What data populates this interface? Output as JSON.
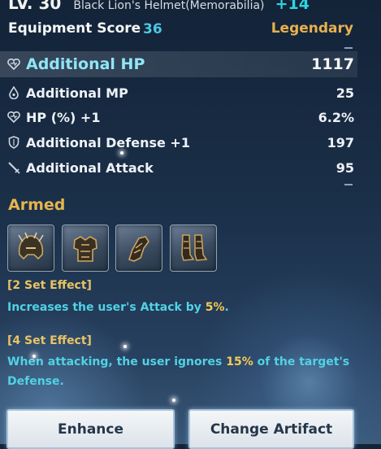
{
  "header": {
    "level": "LV. 30",
    "item_name": "Black Lion's Helmet(Memorabilia)",
    "enhance_level": "+14"
  },
  "score": {
    "label": "Equipment Score",
    "value": "36",
    "rarity": "Legendary"
  },
  "stats": [
    {
      "label": "Additional HP",
      "value": "1117",
      "icon": "heart-icon"
    },
    {
      "label": "Additional MP",
      "value": "25",
      "icon": "droplet-icon"
    },
    {
      "label": "HP (%) +1",
      "value": "6.2%",
      "icon": "heart-icon"
    },
    {
      "label": "Additional Defense +1",
      "value": "197",
      "icon": "shield-icon"
    },
    {
      "label": "Additional Attack",
      "value": "95",
      "icon": "sword-icon"
    }
  ],
  "armed": {
    "title": "Armed",
    "slots": [
      {
        "icon": "helmet-icon"
      },
      {
        "icon": "armor-icon"
      },
      {
        "icon": "gauntlet-icon"
      },
      {
        "icon": "boots-icon"
      }
    ]
  },
  "set_effects": [
    {
      "title": "[2 Set Effect]",
      "desc_before": "Increases the user's Attack by ",
      "highlight": "5%",
      "desc_after": "."
    },
    {
      "title": "[4 Set Effect]",
      "desc_before": "When attacking, the user ignores ",
      "highlight": "15%",
      "desc_after": " of the target's Defense."
    }
  ],
  "buttons": {
    "enhance": "Enhance",
    "change_artifact": "Change Artifact"
  },
  "colors": {
    "accent_cyan": "#4cc8e4",
    "legendary_gold": "#e7b14e",
    "set_desc": "#51d2e4",
    "highlight": "#f3cb55"
  }
}
